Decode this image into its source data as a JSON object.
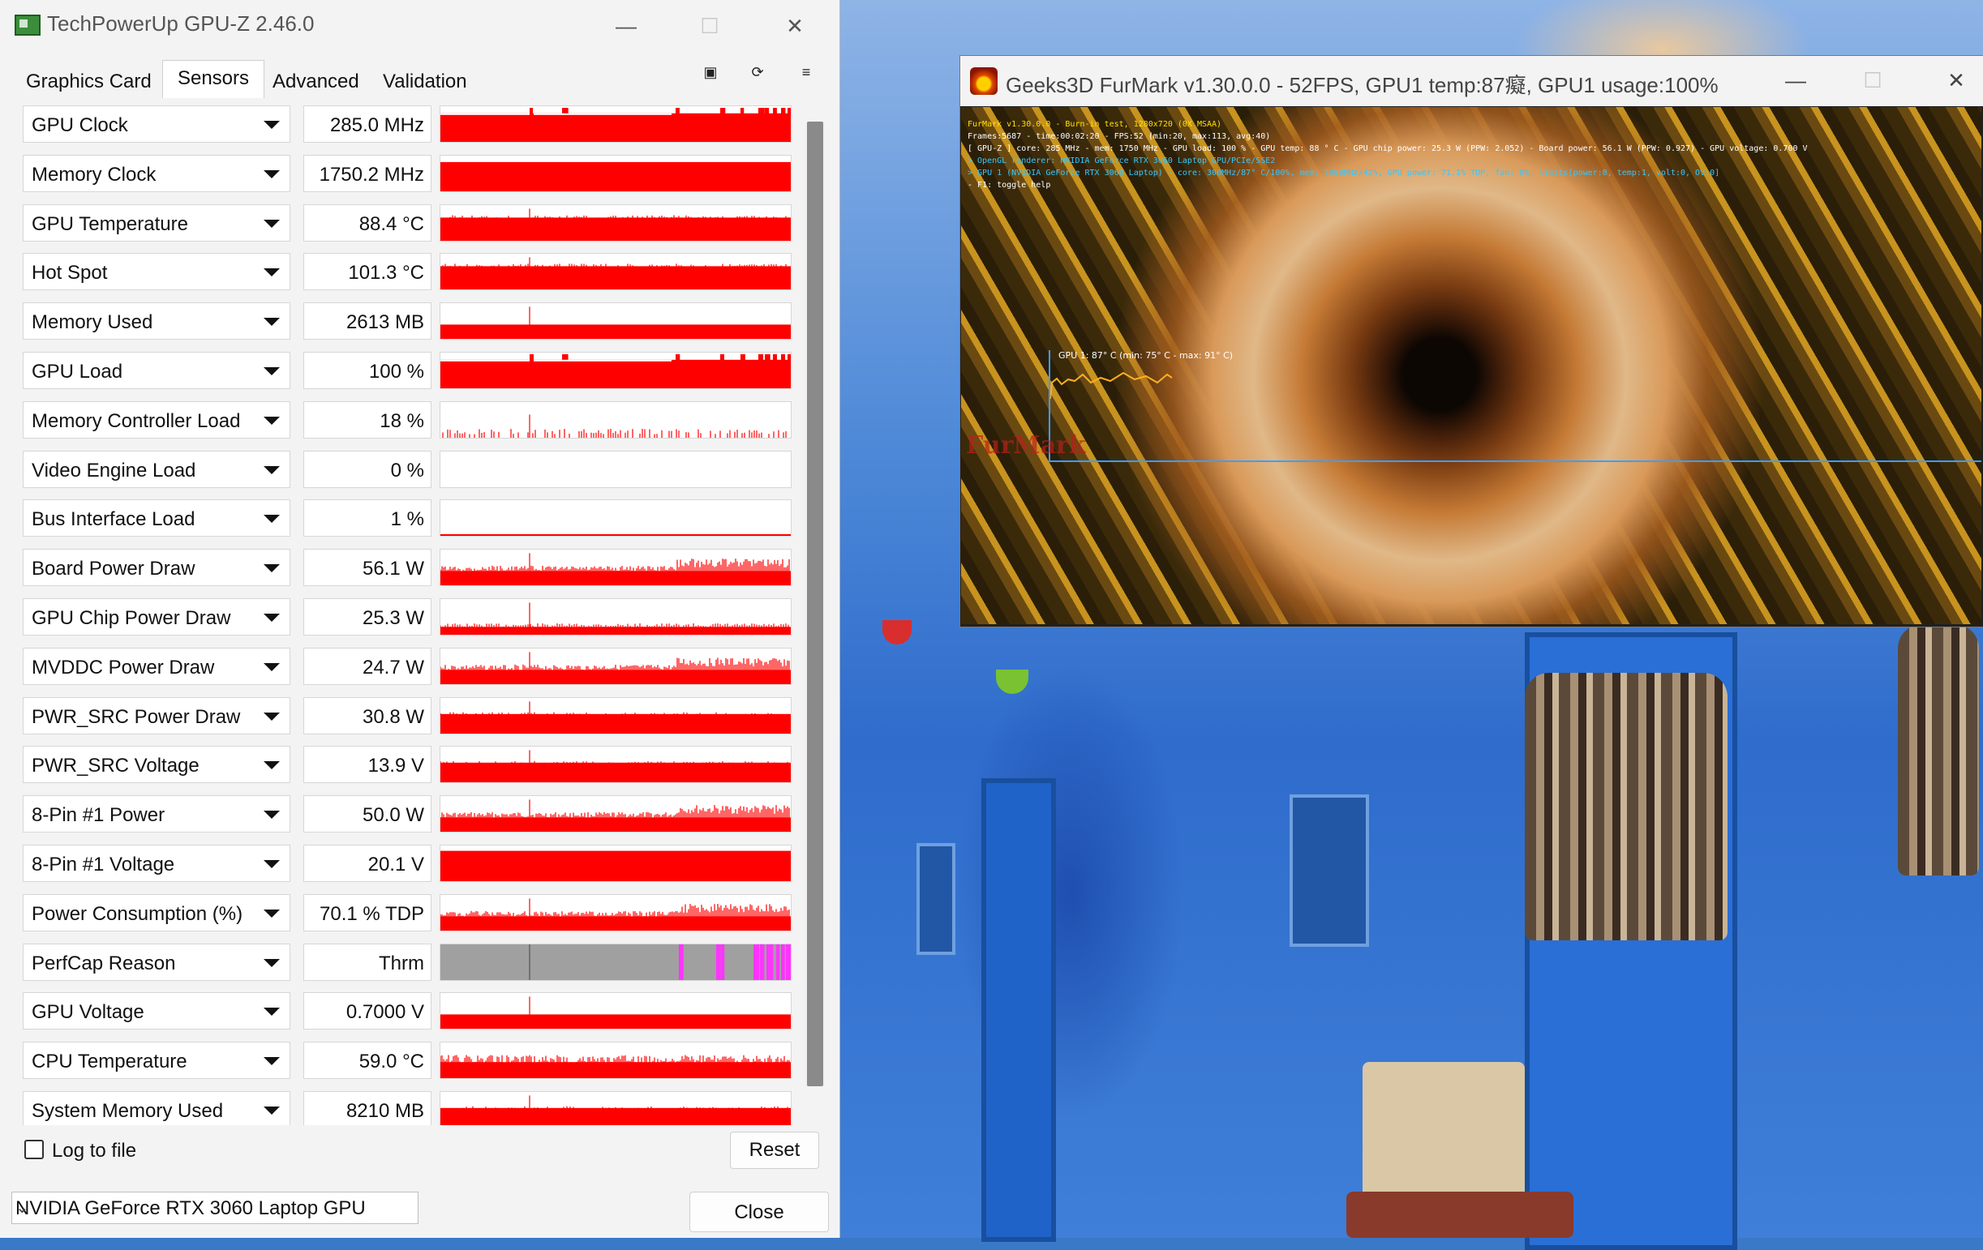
{
  "gpuz": {
    "title": "TechPowerUp GPU-Z 2.46.0",
    "window_controls": {
      "minimize": "—",
      "maximize": "☐",
      "close": "✕"
    },
    "tabs": [
      {
        "label": "Graphics Card",
        "active": false
      },
      {
        "label": "Sensors",
        "active": true
      },
      {
        "label": "Advanced",
        "active": false
      },
      {
        "label": "Validation",
        "active": false
      }
    ],
    "toolbar_icons": [
      "camera-icon",
      "refresh-icon",
      "menu-icon"
    ],
    "sensors": [
      {
        "name": "GPU Clock",
        "value": "285.0 MHz",
        "graph": "spiky-high",
        "color": "#ff0000"
      },
      {
        "name": "Memory Clock",
        "value": "1750.2 MHz",
        "graph": "full",
        "color": "#ff0000"
      },
      {
        "name": "GPU Temperature",
        "value": "88.4 °C",
        "graph": "plateau",
        "color": "#ff0000"
      },
      {
        "name": "Hot Spot",
        "value": "101.3 °C",
        "graph": "plateau",
        "color": "#ff0000"
      },
      {
        "name": "Memory Used",
        "value": "2613 MB",
        "graph": "low-band",
        "color": "#ff0000"
      },
      {
        "name": "GPU Load",
        "value": "100 %",
        "graph": "spiky-high",
        "color": "#ff0000"
      },
      {
        "name": "Memory Controller Load",
        "value": "18 %",
        "graph": "sparse",
        "color": "#ff0000"
      },
      {
        "name": "Video Engine Load",
        "value": "0 %",
        "graph": "empty",
        "color": "#ff0000"
      },
      {
        "name": "Bus Interface Load",
        "value": "1 %",
        "graph": "flat-line",
        "color": "#ff0000"
      },
      {
        "name": "Board Power Draw",
        "value": "56.1 W",
        "graph": "mid-noise",
        "color": "#ff0000"
      },
      {
        "name": "GPU Chip Power Draw",
        "value": "25.3 W",
        "graph": "low-noise",
        "color": "#ff0000"
      },
      {
        "name": "MVDDC Power Draw",
        "value": "24.7 W",
        "graph": "mid-noise",
        "color": "#ff0000"
      },
      {
        "name": "PWR_SRC Power Draw",
        "value": "30.8 W",
        "graph": "mid-band",
        "color": "#ff0000"
      },
      {
        "name": "PWR_SRC Voltage",
        "value": "13.9 V",
        "graph": "mid-band",
        "color": "#ff0000"
      },
      {
        "name": "8-Pin #1 Power",
        "value": "50.0 W",
        "graph": "mid-noise",
        "color": "#ff0000"
      },
      {
        "name": "8-Pin #1 Voltage",
        "value": "20.1 V",
        "graph": "full-tall",
        "color": "#ff0000"
      },
      {
        "name": "Power Consumption (%)",
        "value": "70.1 % TDP",
        "graph": "mid-noise",
        "color": "#ff0000"
      },
      {
        "name": "PerfCap Reason",
        "value": "Thrm",
        "graph": "perfcap",
        "color": "#a0a0a0",
        "accent": "#ff33ff"
      },
      {
        "name": "GPU Voltage",
        "value": "0.7000 V",
        "graph": "low-band",
        "color": "#ff0000"
      },
      {
        "name": "CPU Temperature",
        "value": "59.0 °C",
        "graph": "wavy",
        "color": "#ff0000"
      },
      {
        "name": "System Memory Used",
        "value": "8210 MB",
        "graph": "mid-band",
        "color": "#ff0000"
      }
    ],
    "log_to_file": {
      "label": "Log to file",
      "checked": false
    },
    "reset_label": "Reset",
    "gpu_select": "NVIDIA GeForce RTX 3060 Laptop GPU",
    "close_label": "Close"
  },
  "furmark": {
    "title": "Geeks3D FurMark v1.30.0.0 - 52FPS, GPU1 temp:87癡, GPU1 usage:100%",
    "window_controls": {
      "minimize": "—",
      "maximize": "☐",
      "close": "✕"
    },
    "overlay_lines": [
      {
        "text": "FurMark v1.30.0.0 - Burn-in test, 1280x720 (0X MSAA)",
        "color": "#ffe000"
      },
      {
        "text": "Frames:5687 - time:00:02:20 - FPS:52 (min:20, max:113, avg:40)",
        "color": "#ffffff"
      },
      {
        "text": "[ GPU-Z ] core: 285 MHz - mem: 1750 MHz - GPU load: 100 % - GPU temp: 88 ° C - GPU chip power: 25.3 W (PPW: 2.052) - Board power: 56.1 W (PPW: 0.927) - GPU voltage: 0.700 V",
        "color": "#ffffff"
      },
      {
        "text": "> OpenGL renderer: NVIDIA GeForce RTX 3060 Laptop GPU/PCIe/SSE2",
        "color": "#35c8ff"
      },
      {
        "text": "> GPU 1 (NVIDIA GeForce RTX 3060 Laptop) - core: 300MHz/87° C/100%, mem: 7000MHz/42%, GPU power: 71.1% TDP, fan: 0%, limits[power:0, temp:1, volt:0, OV:0]",
        "color": "#35c8ff"
      },
      {
        "text": "- F1: toggle help",
        "color": "#ffffff"
      }
    ],
    "temp_graph_label": "GPU 1: 87° C (min: 75° C - max: 91° C)",
    "logo_text": "FurMark"
  }
}
